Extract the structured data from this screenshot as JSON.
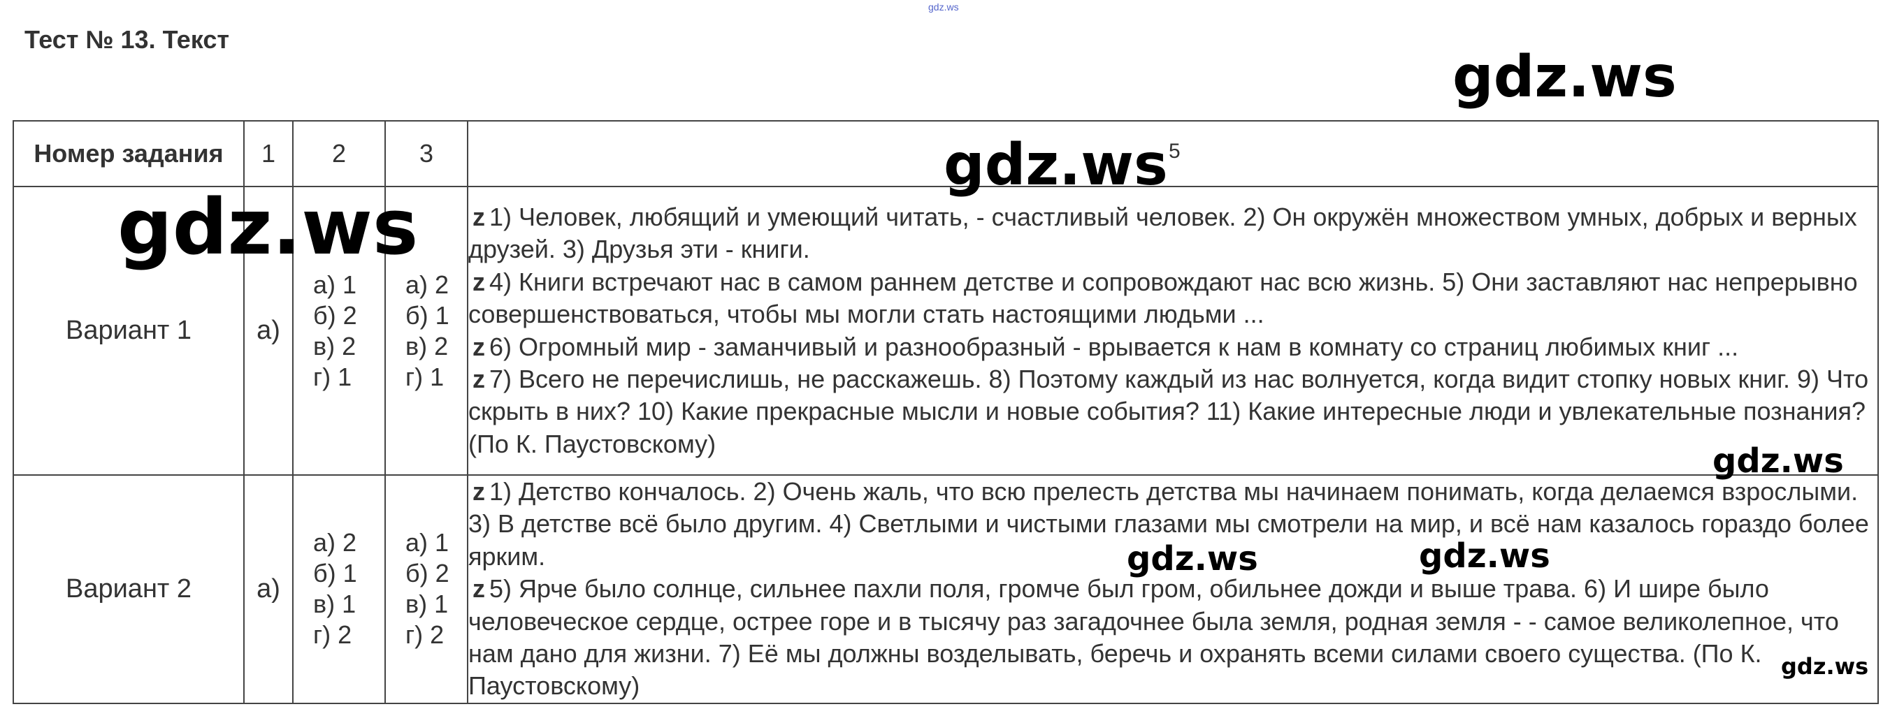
{
  "header": {
    "site_small": "gdz.ws",
    "title": "Тест № 13. Текст"
  },
  "watermarks": [
    "gdz.ws",
    "gdz.ws",
    "gdz.ws",
    "gdz.ws",
    "gdz.ws",
    "gdz.ws",
    "gdz.ws"
  ],
  "table": {
    "headers": {
      "number": "Номер задания",
      "c1": "1",
      "c2": "2",
      "c3": "3",
      "c5": "5"
    },
    "rows": [
      {
        "variant": "Вариант 1",
        "col1": "а)",
        "col2": [
          "а) 1",
          "б) 2",
          "в) 2",
          "г) 1"
        ],
        "col3": [
          "а) 2",
          "б) 1",
          "в) 2",
          "г) 1"
        ],
        "marker": "z",
        "paragraphs": [
          "1) Человек, любящий и умеющий читать, - счастливый человек. 2) Он окружён множеством умных, добрых и верных друзей. 3) Друзья эти - книги.",
          "4) Книги встречают нас в самом раннем детстве и сопровождают нас всю жизнь. 5) Они заставляют нас непрерывно совершенствоваться, чтобы мы могли стать настоящими людьми ...",
          "6) Огромный мир - заманчивый и разнообразный - врывается к нам в комнату со страниц любимых книг ...",
          "7) Всего не перечислишь, не расскажешь. 8) Поэтому каждый из нас волнуется, когда видит стопку новых книг. 9) Что скрыть в них? 10) Какие прекрасные мысли и новые события? 11) Какие интересные люди и увлекательные познания? (По К. Паустовскому)"
        ]
      },
      {
        "variant": "Вариант 2",
        "col1": "а)",
        "col2": [
          "а) 2",
          "б) 1",
          "в) 1",
          "г) 2"
        ],
        "col3": [
          "а) 1",
          "б) 2",
          "в) 1",
          "г) 2"
        ],
        "marker": "z",
        "paragraphs": [
          "1) Детство кончалось. 2) Очень жаль, что всю прелесть детства мы начинаем понимать, когда делаемся взрослыми. 3) В детстве всё было другим. 4) Светлыми и чистыми глазами мы смотрели на мир, и всё нам казалось гораздо более ярким.",
          "5) Ярче было солнце, сильнее пахли поля, громче был гром, обильнее дожди и выше трава. 6) И шире было человеческое сердце, острее горе и в тысячу раз загадочнее была земля, родная земля - - самое великолепное, что нам дано для жизни. 7) Её мы должны возделывать, беречь и охранять всеми силами своего существа. (По К. Паустовскому)"
        ]
      }
    ]
  }
}
